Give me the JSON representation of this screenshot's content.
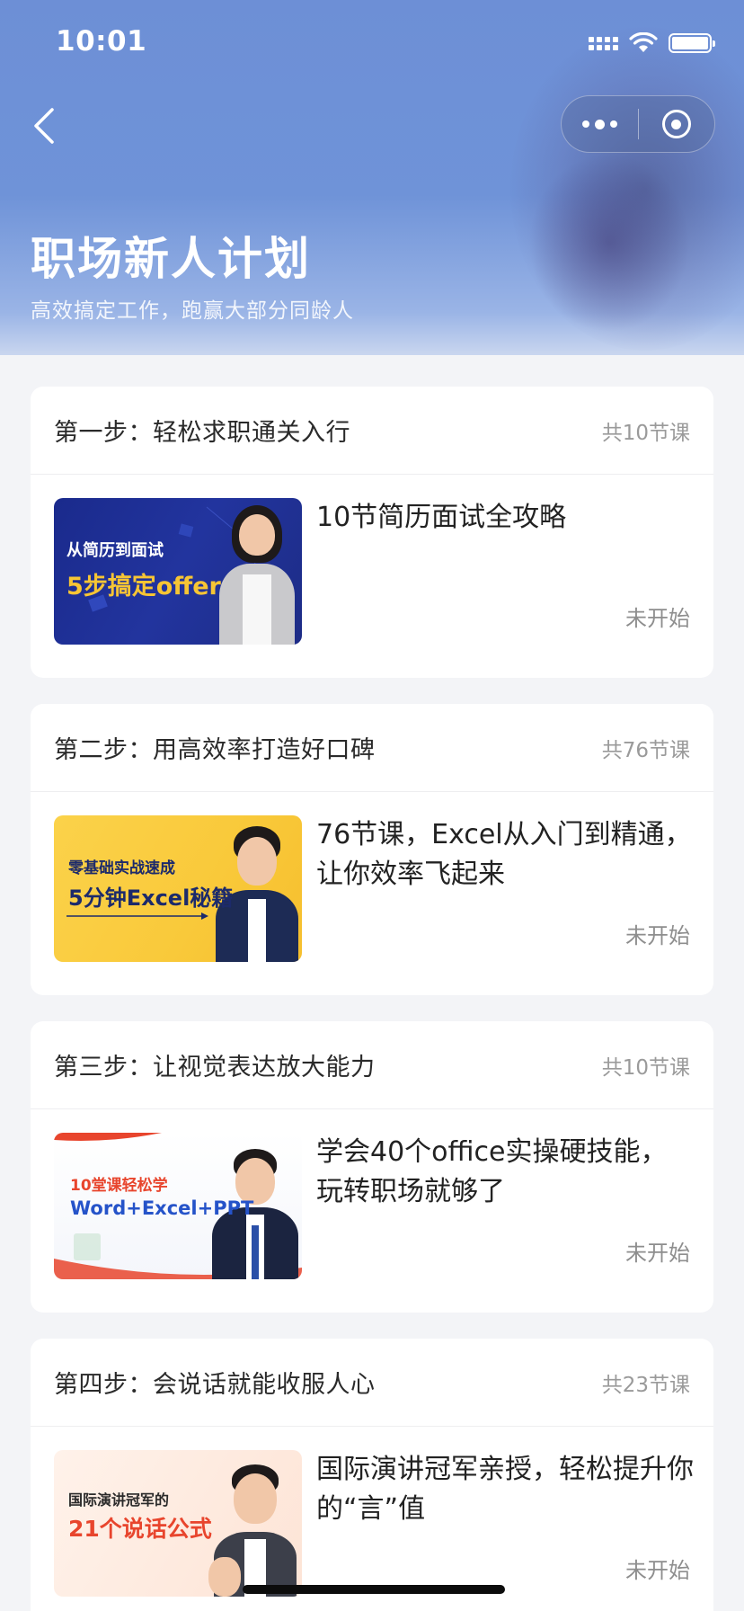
{
  "status_bar": {
    "time": "10:01"
  },
  "header": {
    "title": "职场新人计划",
    "subtitle": "高效搞定工作，跑赢大部分同龄人"
  },
  "steps": [
    {
      "title": "第一步：轻松求职通关入行",
      "count": "共10节课",
      "course": "10节简历面试全攻略",
      "status": "未开始",
      "thumb": {
        "line1": "从简历到面试",
        "line2": "5步搞定offer"
      }
    },
    {
      "title": "第二步：用高效率打造好口碑",
      "count": "共76节课",
      "course": "76节课，Excel从入门到精通，让你效率飞起来",
      "status": "未开始",
      "thumb": {
        "line1": "零基础实战速成",
        "line2": "5分钟Excel秘籍"
      }
    },
    {
      "title": "第三步：让视觉表达放大能力",
      "count": "共10节课",
      "course": "学会40个office实操硬技能，玩转职场就够了",
      "status": "未开始",
      "thumb": {
        "line1": "10堂课轻松学",
        "line2": "Word+Excel+PPT"
      }
    },
    {
      "title": "第四步：会说话就能收服人心",
      "count": "共23节课",
      "course": "国际演讲冠军亲授，轻松提升你的“言”值",
      "status": "未开始",
      "thumb": {
        "line1": "国际演讲冠军的",
        "line2": "21个说话公式"
      }
    }
  ],
  "colors": {
    "header_blue": "#6f93d8",
    "background": "#f3f4f7",
    "card": "#ffffff",
    "muted": "#9a9a9a"
  }
}
